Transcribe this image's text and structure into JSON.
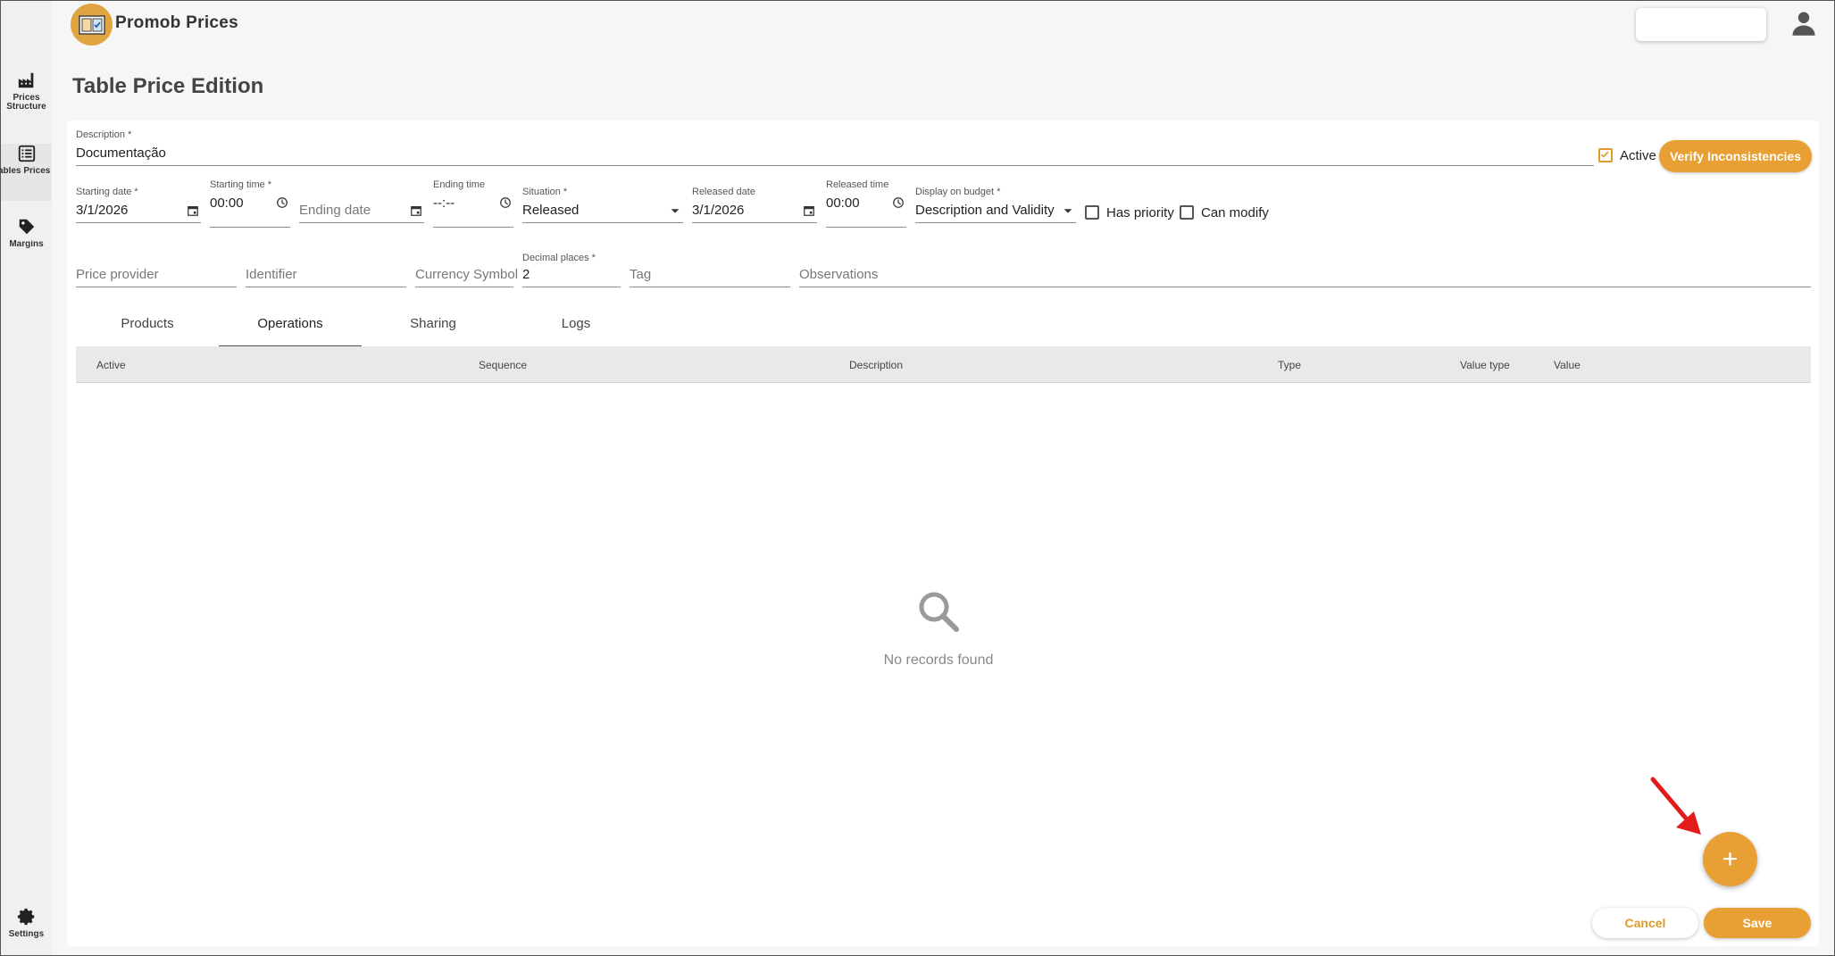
{
  "app": {
    "title": "Promob Prices"
  },
  "sidebar": {
    "items": [
      {
        "label": "Prices Structure",
        "icon": "factory-icon"
      },
      {
        "label": "Tables Prices",
        "icon": "list-icon"
      },
      {
        "label": "Margins",
        "icon": "tag-icon"
      }
    ],
    "settings_label": "Settings"
  },
  "page": {
    "title": "Table Price Edition"
  },
  "form": {
    "description": {
      "label": "Description *",
      "value": "Documentação"
    },
    "active": {
      "label": "Active",
      "checked": true
    },
    "verify_label": "Verify Inconsistencies",
    "starting_date": {
      "label": "Starting date *",
      "value": "3/1/2026"
    },
    "starting_time": {
      "label": "Starting time *",
      "value": "00:00"
    },
    "ending_date": {
      "placeholder": "Ending date"
    },
    "ending_time": {
      "label": "Ending time",
      "value": "--:--"
    },
    "situation": {
      "label": "Situation *",
      "value": "Released"
    },
    "released_date": {
      "label": "Released date",
      "value": "3/1/2026"
    },
    "released_time": {
      "label": "Released time",
      "value": "00:00"
    },
    "display_on_budget": {
      "label": "Display on budget *",
      "value": "Description and Validity"
    },
    "has_priority": {
      "label": "Has priority",
      "checked": false
    },
    "can_modify": {
      "label": "Can modify",
      "checked": false
    },
    "price_provider": {
      "placeholder": "Price provider"
    },
    "identifier": {
      "placeholder": "Identifier"
    },
    "currency_symbol": {
      "placeholder": "Currency Symbol"
    },
    "decimal_places": {
      "label": "Decimal places *",
      "value": "2"
    },
    "tag": {
      "placeholder": "Tag"
    },
    "observations": {
      "placeholder": "Observations"
    }
  },
  "tabs": [
    {
      "label": "Products"
    },
    {
      "label": "Operations",
      "active": true
    },
    {
      "label": "Sharing"
    },
    {
      "label": "Logs"
    }
  ],
  "table": {
    "columns": [
      "Active",
      "Sequence",
      "Description",
      "Type",
      "Value type",
      "Value"
    ],
    "empty_text": "No records found"
  },
  "actions": {
    "add": "+",
    "cancel": "Cancel",
    "save": "Save"
  },
  "colors": {
    "accent": "#e8a034"
  }
}
